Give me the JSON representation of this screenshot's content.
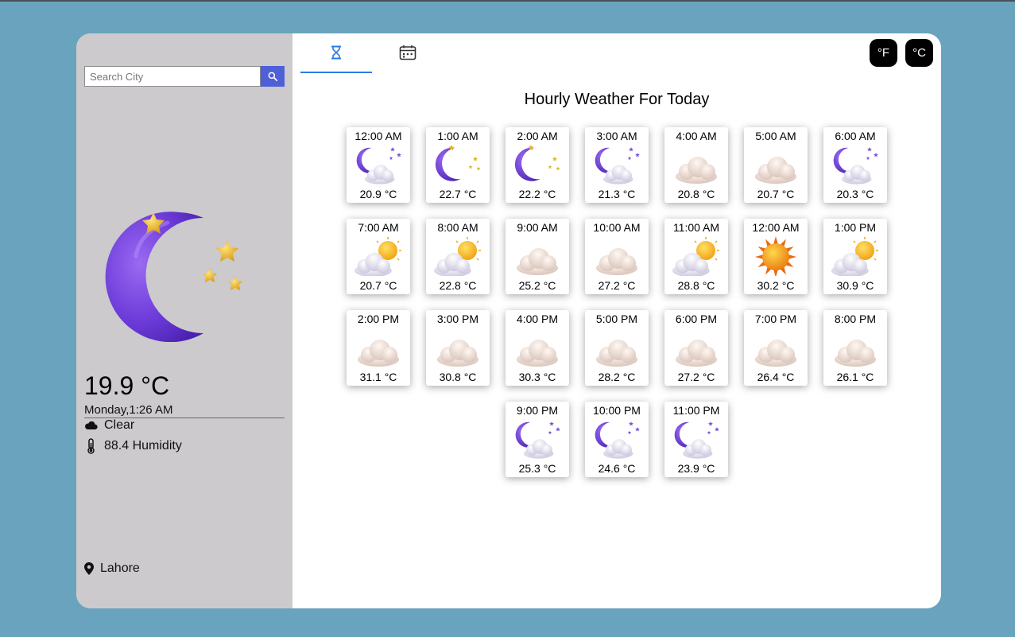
{
  "search": {
    "placeholder": "Search City"
  },
  "current": {
    "icon": "moon-stars-icon",
    "temperature": "19.9 °C",
    "datetime": "Monday,1:26 AM",
    "condition": "Clear",
    "humidity": "88.4 Humidity",
    "location": "Lahore"
  },
  "tabs": [
    {
      "icon": "hourglass-icon",
      "active": true
    },
    {
      "icon": "calendar-icon",
      "active": false
    }
  ],
  "units": {
    "fahrenheit": "°F",
    "celsius": "°C"
  },
  "heading": "Hourly Weather For Today",
  "hourly": [
    {
      "time": "12:00 AM",
      "temp": "20.9 °C",
      "icon": "night-cloud"
    },
    {
      "time": "1:00 AM",
      "temp": "22.7 °C",
      "icon": "moon"
    },
    {
      "time": "2:00 AM",
      "temp": "22.2 °C",
      "icon": "moon"
    },
    {
      "time": "3:00 AM",
      "temp": "21.3 °C",
      "icon": "night-cloud"
    },
    {
      "time": "4:00 AM",
      "temp": "20.8 °C",
      "icon": "cloud"
    },
    {
      "time": "5:00 AM",
      "temp": "20.7 °C",
      "icon": "cloud"
    },
    {
      "time": "6:00 AM",
      "temp": "20.3 °C",
      "icon": "night-cloud"
    },
    {
      "time": "7:00 AM",
      "temp": "20.7 °C",
      "icon": "partly-sunny"
    },
    {
      "time": "8:00 AM",
      "temp": "22.8 °C",
      "icon": "partly-sunny"
    },
    {
      "time": "9:00 AM",
      "temp": "25.2 °C",
      "icon": "cloud"
    },
    {
      "time": "10:00 AM",
      "temp": "27.2 °C",
      "icon": "cloud"
    },
    {
      "time": "11:00 AM",
      "temp": "28.8 °C",
      "icon": "partly-sunny"
    },
    {
      "time": "12:00 AM",
      "temp": "30.2 °C",
      "icon": "sun"
    },
    {
      "time": "1:00 PM",
      "temp": "30.9 °C",
      "icon": "partly-sunny"
    },
    {
      "time": "2:00 PM",
      "temp": "31.1 °C",
      "icon": "cloud"
    },
    {
      "time": "3:00 PM",
      "temp": "30.8 °C",
      "icon": "cloud"
    },
    {
      "time": "4:00 PM",
      "temp": "30.3 °C",
      "icon": "cloud"
    },
    {
      "time": "5:00 PM",
      "temp": "28.2 °C",
      "icon": "cloud"
    },
    {
      "time": "6:00 PM",
      "temp": "27.2 °C",
      "icon": "cloud"
    },
    {
      "time": "7:00 PM",
      "temp": "26.4 °C",
      "icon": "cloud"
    },
    {
      "time": "8:00 PM",
      "temp": "26.1 °C",
      "icon": "cloud"
    },
    {
      "time": "9:00 PM",
      "temp": "25.3 °C",
      "icon": "night-cloud"
    },
    {
      "time": "10:00 PM",
      "temp": "24.6 °C",
      "icon": "night-cloud"
    },
    {
      "time": "11:00 PM",
      "temp": "23.9 °C",
      "icon": "night-cloud"
    }
  ]
}
